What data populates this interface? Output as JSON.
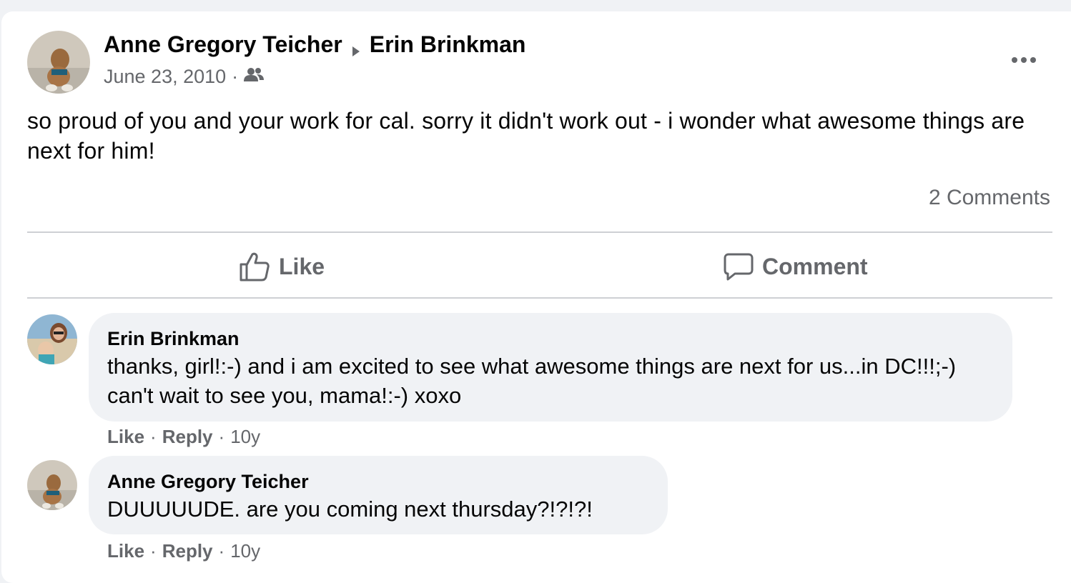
{
  "post": {
    "author": "Anne Gregory Teicher",
    "recipient": "Erin Brinkman",
    "date": "June 23, 2010",
    "meta_separator": "·",
    "audience_icon": "friends-icon",
    "more_icon": "more-options-icon",
    "text": "so proud of you and your work for cal. sorry it didn't work out - i wonder what awesome things are next for him!",
    "comments_count": "2 Comments"
  },
  "actions": {
    "like_label": "Like",
    "comment_label": "Comment"
  },
  "comments": [
    {
      "author": "Erin Brinkman",
      "text": "thanks, girl!:-) and i am excited to see what awesome things are next for us...in DC!!!;-) can't wait to see you, mama!:-) xoxo",
      "like_label": "Like",
      "reply_label": "Reply",
      "time": "10y"
    },
    {
      "author": "Anne Gregory Teicher",
      "text": "DUUUUUDE. are you coming next thursday?!?!?!",
      "like_label": "Like",
      "reply_label": "Reply",
      "time": "10y"
    }
  ],
  "colors": {
    "secondary_text": "#65676b",
    "bubble_bg": "#f0f2f5",
    "divider": "#ced0d4"
  }
}
